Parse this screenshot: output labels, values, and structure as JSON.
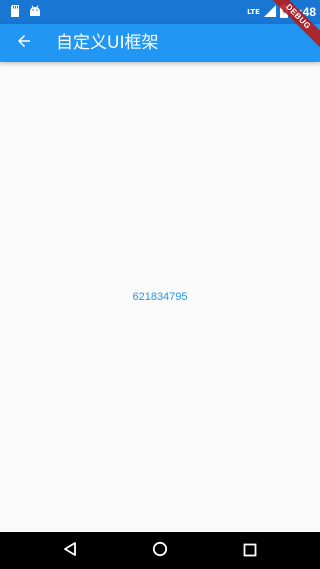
{
  "status_bar": {
    "network_label": "LTE",
    "time": "1:48",
    "icons": [
      "sd-card-icon",
      "android-icon",
      "signal-icon",
      "battery-icon"
    ]
  },
  "app_bar": {
    "title": "自定义UI框架",
    "back_icon": "arrow-back-icon",
    "background": "#2196f3"
  },
  "debug_banner": "DEBUG",
  "content": {
    "number": "621834795",
    "color": "#2196f3"
  },
  "nav_bar": {
    "buttons": [
      "back-triangle-icon",
      "home-circle-icon",
      "recents-square-icon"
    ]
  }
}
